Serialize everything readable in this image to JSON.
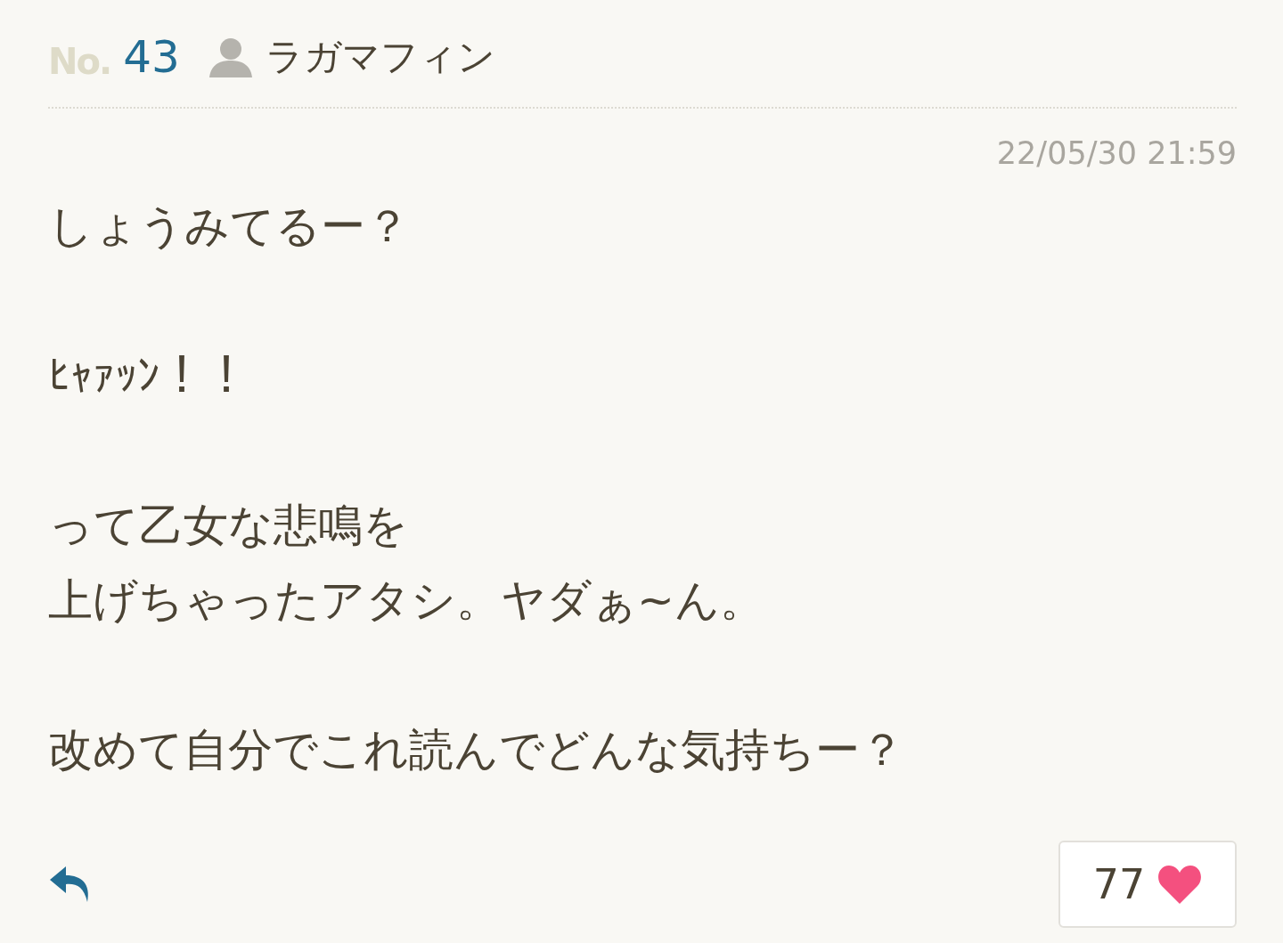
{
  "post": {
    "number_prefix": "No.",
    "number": "43",
    "author": "ラガマフィン",
    "date": "22/05/30 21:59",
    "paragraphs": [
      [
        "しょうみてるー？"
      ],
      [
        "ﾋｬｧｯﾝ！！"
      ],
      [
        "って乙女な悲鳴を",
        "上げちゃったアタシ。ヤダぁ~ん。"
      ],
      [
        "改めて自分でこれ読んでどんな気持ちー？"
      ]
    ],
    "likes": "77"
  }
}
